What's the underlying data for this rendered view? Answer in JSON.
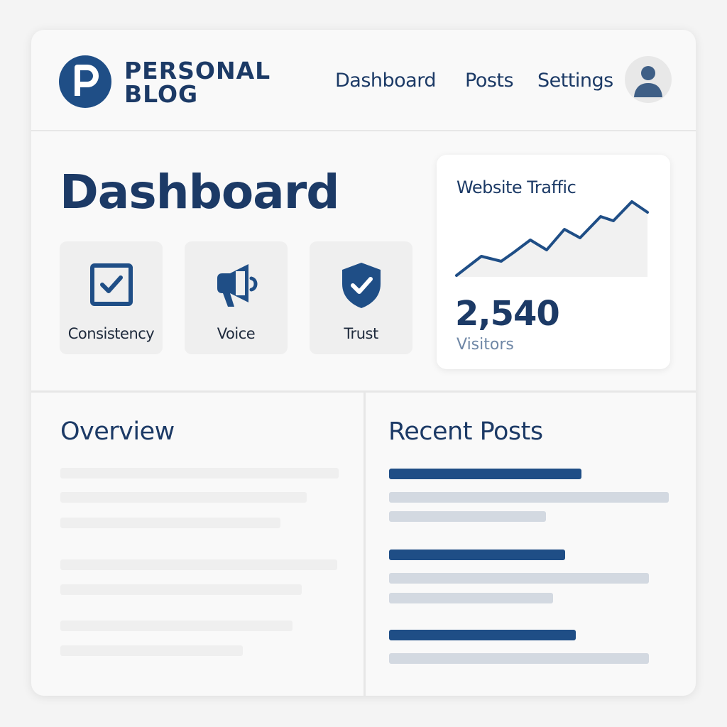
{
  "header": {
    "logo_letter": "P",
    "brand_line1": "PERSONAL",
    "brand_line2": "BLOG",
    "nav": [
      {
        "label": "Dashboard"
      },
      {
        "label": "Posts"
      },
      {
        "label": "Settings"
      }
    ],
    "avatar_icon": "user-avatar-icon"
  },
  "main": {
    "title": "Dashboard",
    "values": [
      {
        "label": "Consistency",
        "icon": "checkbox-icon"
      },
      {
        "label": "Voice",
        "icon": "megaphone-icon"
      },
      {
        "label": "Trust",
        "icon": "shield-check-icon"
      }
    ]
  },
  "traffic": {
    "title": "Website Traffic",
    "value": "2,540",
    "unit": "Visitors"
  },
  "overview": {
    "title": "Overview"
  },
  "recent_posts": {
    "title": "Recent Posts"
  },
  "colors": {
    "primary": "#1f4e86",
    "text_dark": "#1c3a66",
    "muted_text": "#6f87a6",
    "placeholder_light": "#efefef",
    "placeholder_mid": "#d3d9e1"
  }
}
